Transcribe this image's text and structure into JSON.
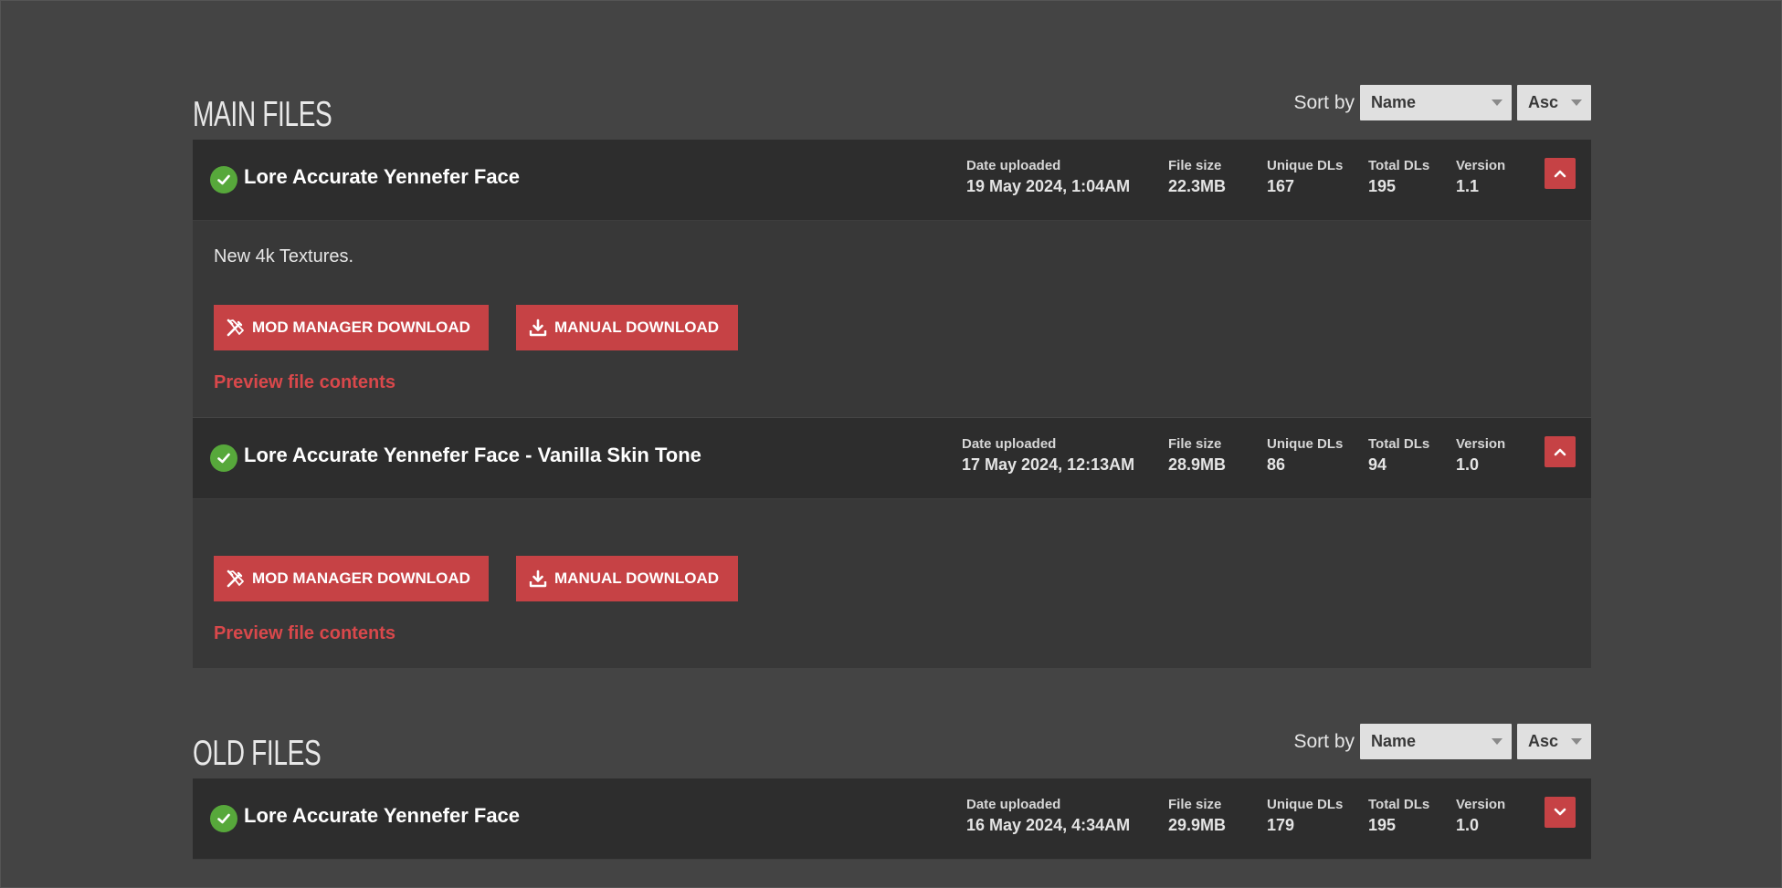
{
  "sections": {
    "main": {
      "title": "MAIN FILES",
      "sort_label": "Sort by",
      "sort_field": "Name",
      "sort_order": "Asc"
    },
    "old": {
      "title": "OLD FILES",
      "sort_label": "Sort by",
      "sort_field": "Name",
      "sort_order": "Asc"
    }
  },
  "stat_labels": {
    "date": "Date uploaded",
    "size": "File size",
    "unique": "Unique DLs",
    "total": "Total DLs",
    "version": "Version"
  },
  "buttons": {
    "mod_manager": "MOD MANAGER DOWNLOAD",
    "manual": "MANUAL DOWNLOAD",
    "preview": "Preview file contents"
  },
  "main_files": [
    {
      "name": "Lore Accurate Yennefer Face",
      "date": "19 May 2024, 1:04AM",
      "size": "22.3MB",
      "unique": "167",
      "total": "195",
      "version": "1.1",
      "description": "New 4k Textures.",
      "expanded": true
    },
    {
      "name": "Lore Accurate Yennefer Face - Vanilla Skin Tone",
      "date": "17 May 2024, 12:13AM",
      "size": "28.9MB",
      "unique": "86",
      "total": "94",
      "version": "1.0",
      "description": "",
      "expanded": true
    }
  ],
  "old_files": [
    {
      "name": "Lore Accurate Yennefer Face",
      "date": "16 May 2024, 4:34AM",
      "size": "29.9MB",
      "unique": "179",
      "total": "195",
      "version": "1.0",
      "expanded": false
    }
  ],
  "colors": {
    "accent": "#c64245",
    "check": "#57a83b",
    "background": "#444444",
    "header_bg": "#2d2d2d",
    "body_bg": "#383838"
  }
}
